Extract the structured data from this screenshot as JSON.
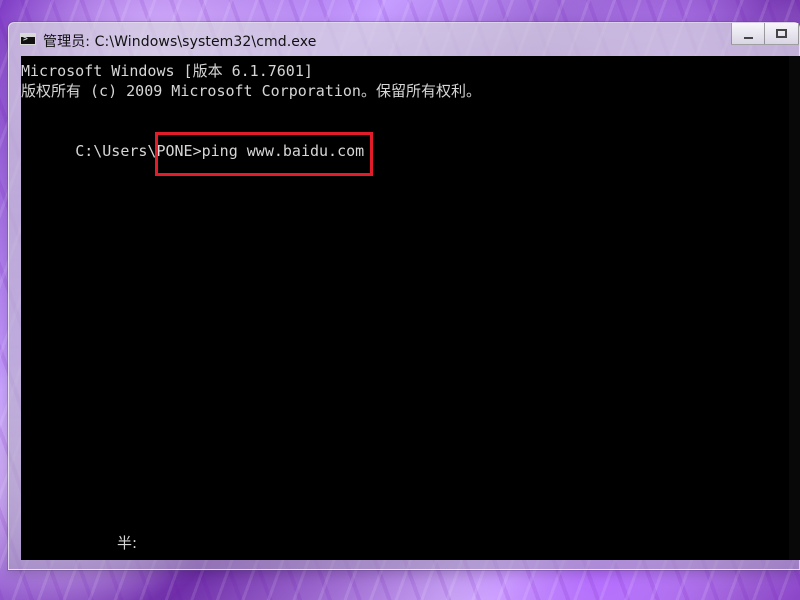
{
  "window": {
    "title": "管理员: C:\\Windows\\system32\\cmd.exe",
    "icon_name": "command-prompt-icon",
    "controls": {
      "minimize_icon": "minimize-icon",
      "maximize_icon": "maximize-icon"
    }
  },
  "console": {
    "lines": [
      "Microsoft Windows [版本 6.1.7601]",
      "版权所有 (c) 2009 Microsoft Corporation。保留所有权利。"
    ],
    "prompt_path": "C:\\Users\\PONE>",
    "command": "ping www.baidu.com",
    "ime_status": "半:"
  },
  "colors": {
    "console_background": "#000000",
    "console_text": "#d6d6d6",
    "highlight_border": "#e31c2a"
  }
}
